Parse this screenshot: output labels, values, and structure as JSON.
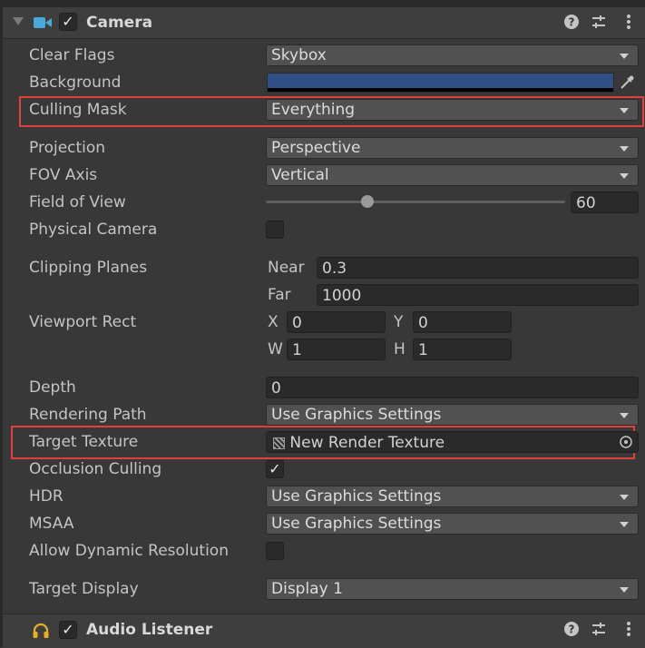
{
  "camera": {
    "title": "Camera",
    "enabled_check": "✓",
    "icons": [
      "help-icon",
      "preset-icon",
      "more-icon"
    ]
  },
  "fields": {
    "clear_flags": {
      "label": "Clear Flags",
      "value": "Skybox"
    },
    "background": {
      "label": "Background",
      "color": "#2f4f85"
    },
    "culling_mask": {
      "label": "Culling Mask",
      "value": "Everything"
    },
    "projection": {
      "label": "Projection",
      "value": "Perspective"
    },
    "fov_axis": {
      "label": "FOV Axis",
      "value": "Vertical"
    },
    "field_of_view": {
      "label": "Field of View",
      "value": "60",
      "slider_fraction": 0.34
    },
    "physical_camera": {
      "label": "Physical Camera",
      "checked": false
    },
    "clipping_planes": {
      "label": "Clipping Planes",
      "near_label": "Near",
      "near": "0.3",
      "far_label": "Far",
      "far": "1000"
    },
    "viewport_rect": {
      "label": "Viewport Rect",
      "x_label": "X",
      "x": "0",
      "y_label": "Y",
      "y": "0",
      "w_label": "W",
      "w": "1",
      "h_label": "H",
      "h": "1"
    },
    "depth": {
      "label": "Depth",
      "value": "0"
    },
    "rendering_path": {
      "label": "Rendering Path",
      "value": "Use Graphics Settings"
    },
    "target_texture": {
      "label": "Target Texture",
      "value": "New Render Texture"
    },
    "occlusion_culling": {
      "label": "Occlusion Culling",
      "checked": true,
      "check": "✓"
    },
    "hdr": {
      "label": "HDR",
      "value": "Use Graphics Settings"
    },
    "msaa": {
      "label": "MSAA",
      "value": "Use Graphics Settings"
    },
    "allow_dynamic_resolution": {
      "label": "Allow Dynamic Resolution",
      "checked": false
    },
    "target_display": {
      "label": "Target Display",
      "value": "Display 1"
    }
  },
  "audio_listener": {
    "title": "Audio Listener",
    "enabled_check": "✓"
  },
  "colors": {
    "accent_highlight": "#e0403c",
    "camera_icon": "#4aa8d8",
    "audio_icon": "#e8b020"
  }
}
